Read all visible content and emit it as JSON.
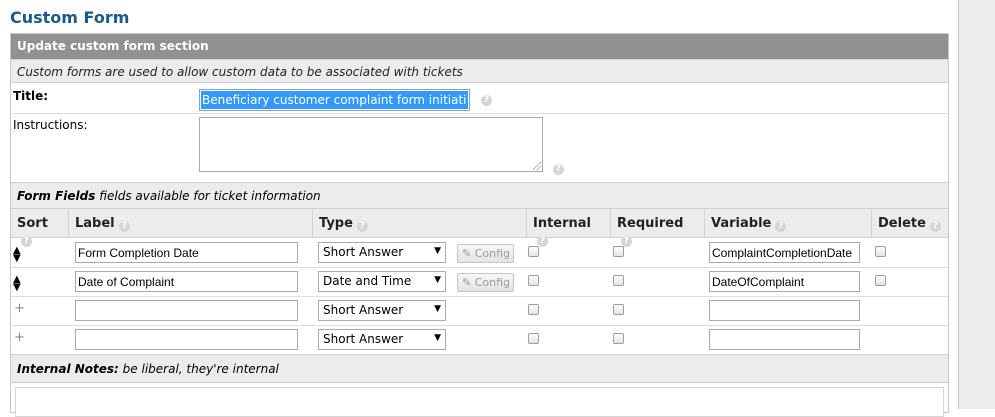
{
  "page": {
    "title": "Custom Form"
  },
  "section": {
    "header": "Update custom form section",
    "description": "Custom forms are used to allow custom data to be associated with tickets"
  },
  "title_field": {
    "label": "Title:",
    "value": "Beneficiary customer complaint form initiation"
  },
  "instructions_field": {
    "label": "Instructions:",
    "value": ""
  },
  "form_fields": {
    "heading": "Form Fields",
    "subheading": "fields available for ticket information",
    "columns": {
      "sort": "Sort",
      "label": "Label",
      "type": "Type",
      "internal": "Internal",
      "required": "Required",
      "variable": "Variable",
      "delete": "Delete"
    },
    "config_label": "Config",
    "rows": [
      {
        "sort_icon": "sort-updown-icon",
        "label": "Form Completion Date",
        "type": "Short Answer",
        "variable": "ComplaintCompletionDate",
        "internal": false,
        "required": false,
        "delete": false,
        "has_config": true
      },
      {
        "sort_icon": "sort-updown-icon",
        "label": "Date of Complaint",
        "type": "Date and Time",
        "variable": "DateOfComplaint",
        "internal": false,
        "required": false,
        "delete": false,
        "has_config": true
      },
      {
        "sort_icon": "plus-icon",
        "label": "",
        "type": "Short Answer",
        "variable": "",
        "internal": false,
        "required": false,
        "has_config": false
      },
      {
        "sort_icon": "plus-icon",
        "label": "",
        "type": "Short Answer",
        "variable": "",
        "internal": false,
        "required": false,
        "has_config": false
      }
    ]
  },
  "internal_notes": {
    "heading": "Internal Notes:",
    "subheading": "be liberal, they're internal",
    "value": ""
  },
  "colors": {
    "title": "#1b5a8a",
    "section_header_bg": "#919191",
    "selection": "#3399ff"
  }
}
